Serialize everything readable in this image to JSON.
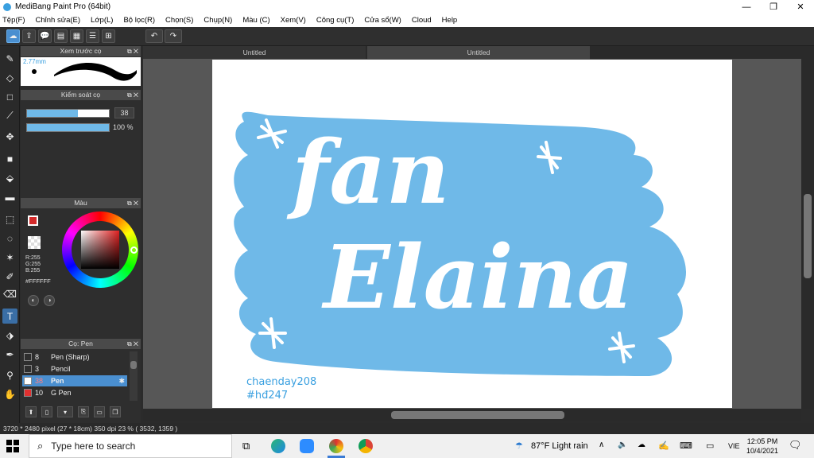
{
  "window": {
    "title": "MediBang Paint Pro (64bit)",
    "minimize": "—",
    "maximize": "❐",
    "close": "✕"
  },
  "menu": [
    "Tệp(F)",
    "Chỉnh sửa(E)",
    "Lớp(L)",
    "Bộ lọc(R)",
    "Chọn(S)",
    "Chụp(N)",
    "Màu (C)",
    "Xem(V)",
    "Công cụ(T)",
    "Cửa sổ(W)",
    "Cloud",
    "Help"
  ],
  "tabs": [
    {
      "label": "Untitled"
    },
    {
      "label": "Untitled"
    }
  ],
  "brush_preview": {
    "title": "Xem trước cọ",
    "size": "2.77mm"
  },
  "brush_control": {
    "title": "Kiểm soát cọ",
    "size_value": "38",
    "opacity_value": "100 %",
    "size_fraction": 0.62,
    "opacity_fraction": 1.0
  },
  "color_panel": {
    "title": "Màu",
    "r": "R:255",
    "g": "G:255",
    "b": "B:255",
    "hex": "#FFFFFF",
    "fg_color": "#d42a2a"
  },
  "brush_panel": {
    "title": "Cọ: Pen",
    "items": [
      {
        "num": "8",
        "name": "Pen (Sharp)",
        "color": "#2e2e2e",
        "selected": false
      },
      {
        "num": "3",
        "name": "Pencil",
        "color": "#2e2e2e",
        "selected": false
      },
      {
        "num": "38",
        "name": "Pen",
        "color": "#ffffff",
        "selected": true
      },
      {
        "num": "10",
        "name": "G Pen",
        "color": "#e03030",
        "selected": false
      }
    ]
  },
  "canvas_art": {
    "line1": "fan",
    "line2": "Elaina",
    "credit1": "chaenday208",
    "credit2": "#hđ247",
    "blob_color": "#6fb9e8",
    "credit_color": "#3aa0e0"
  },
  "status": "3720 * 2480 pixel   (27 * 18cm)   350 dpi   23 %   ( 3532, 1359 )",
  "taskbar": {
    "search_placeholder": "Type here to search",
    "weather": "87°F  Light rain",
    "lang": "VIE",
    "time": "12:05 PM",
    "date": "10/4/2021"
  }
}
